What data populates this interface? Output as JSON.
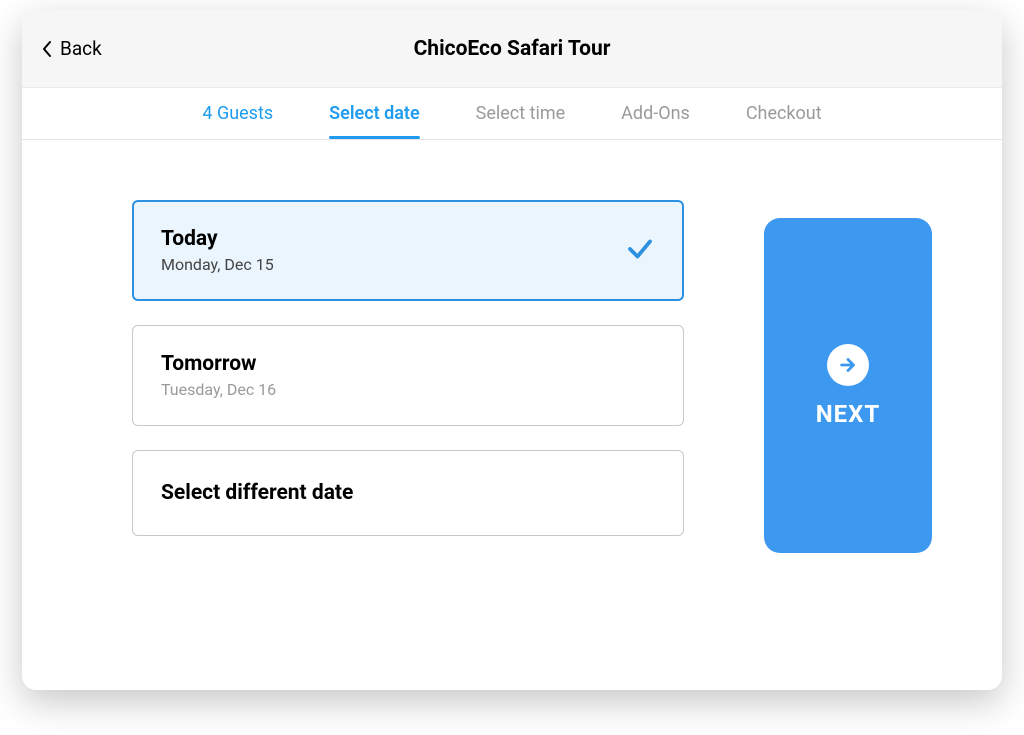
{
  "header": {
    "back_label": "Back",
    "title": "ChicoEco Safari Tour"
  },
  "steps": [
    {
      "label": "4 Guests",
      "state": "done"
    },
    {
      "label": "Select date",
      "state": "active"
    },
    {
      "label": "Select time",
      "state": "pending"
    },
    {
      "label": "Add-Ons",
      "state": "pending"
    },
    {
      "label": "Checkout",
      "state": "pending"
    }
  ],
  "date_options": {
    "today": {
      "title": "Today",
      "subtitle": "Monday, Dec 15",
      "selected": true
    },
    "tomorrow": {
      "title": "Tomorrow",
      "subtitle": "Tuesday, Dec 16",
      "selected": false
    },
    "other": {
      "title": "Select different date"
    }
  },
  "next": {
    "label": "NEXT"
  }
}
